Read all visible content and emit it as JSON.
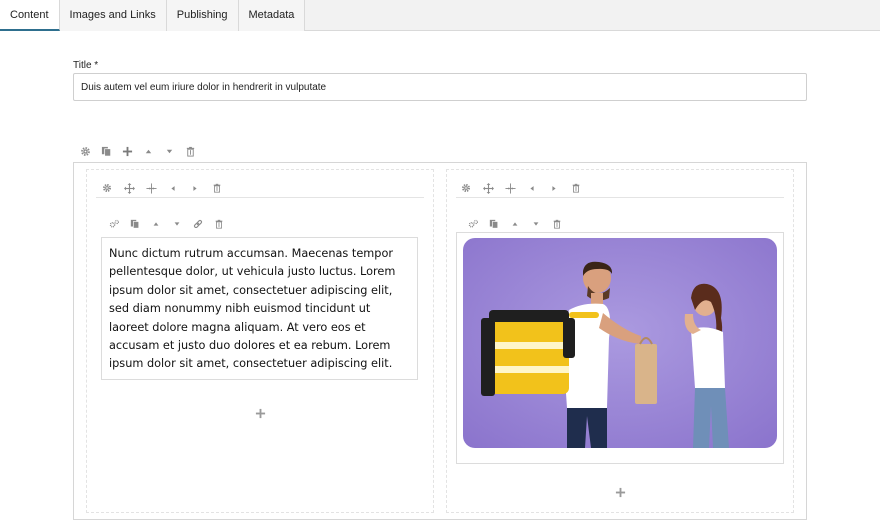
{
  "tabs": [
    {
      "label": "Content",
      "active": true
    },
    {
      "label": "Images and Links",
      "active": false
    },
    {
      "label": "Publishing",
      "active": false
    },
    {
      "label": "Metadata",
      "active": false
    }
  ],
  "title_field": {
    "label": "Title *",
    "value": "Duis autem vel eum iriure dolor in hendrerit in vulputate"
  },
  "text_block": {
    "content": "Nunc dictum rutrum accumsan. Maecenas tempor pellentesque dolor, ut vehicula justo luctus. Lorem ipsum dolor sit amet, consectetuer adipiscing elit, sed diam nonummy nibh euismod tincidunt ut laoreet dolore magna aliquam.  At vero eos et accusam et justo duo dolores et ea rebum. Lorem ipsum dolor sit amet, consectetuer adipiscing elit."
  },
  "icons": {
    "row_toolbar": [
      "gear-icon",
      "copy-icon",
      "plus-icon",
      "arrow-up-icon",
      "arrow-down-icon",
      "trash-icon"
    ],
    "column_toolbar": [
      "gear-icon",
      "move-icon",
      "resize-icon",
      "arrow-left-icon",
      "arrow-right-icon",
      "trash-icon"
    ],
    "text_block_toolbar": [
      "settings-icon",
      "copy-icon",
      "arrow-up-icon",
      "arrow-down-icon",
      "link-icon",
      "trash-icon"
    ],
    "image_block_toolbar": [
      "settings-icon",
      "copy-icon",
      "arrow-up-icon",
      "arrow-down-icon",
      "trash-icon"
    ],
    "add_component": "plus-icon"
  },
  "colors": {
    "active_tab_underline": "#2e6f8e",
    "icon_gray": "#8a8a8a",
    "image_background": "#9b86d6"
  }
}
